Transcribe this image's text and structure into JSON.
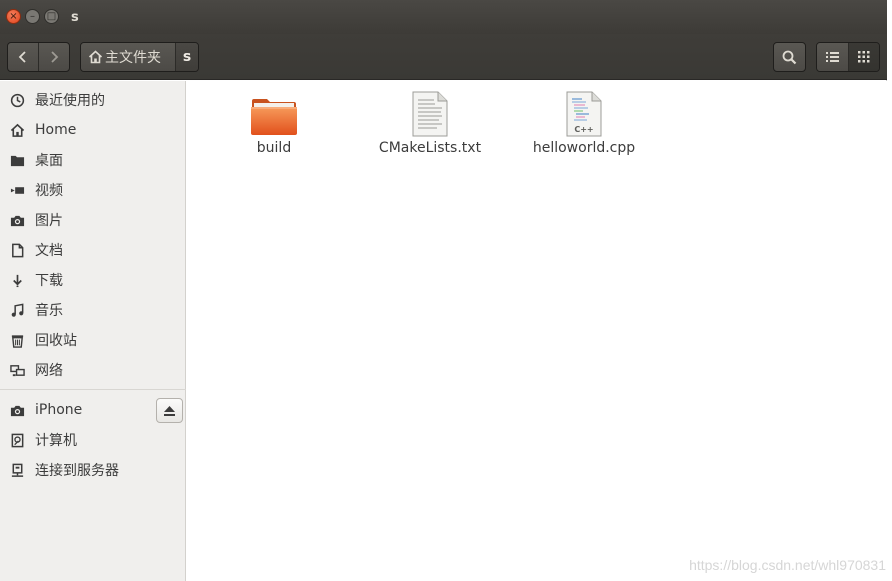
{
  "window": {
    "title": "s",
    "close_glyph": "×",
    "min_glyph": "–",
    "max_glyph": "□"
  },
  "toolbar": {
    "back_icon": "chevron-left-icon",
    "forward_icon": "chevron-right-icon",
    "path": [
      {
        "label": "主文件夹",
        "icon": "home-icon"
      },
      {
        "label": "s"
      }
    ],
    "search_icon": "search-icon",
    "list_view_icon": "list-view-icon",
    "grid_view_icon": "grid-view-icon"
  },
  "sidebar": {
    "places": [
      {
        "label": "最近使用的",
        "icon": "clock-icon"
      },
      {
        "label": "Home",
        "icon": "home-icon"
      },
      {
        "label": "桌面",
        "icon": "folder-icon"
      },
      {
        "label": "视频",
        "icon": "video-icon"
      },
      {
        "label": "图片",
        "icon": "camera-icon"
      },
      {
        "label": "文档",
        "icon": "document-icon"
      },
      {
        "label": "下载",
        "icon": "download-icon"
      },
      {
        "label": "音乐",
        "icon": "music-icon"
      },
      {
        "label": "回收站",
        "icon": "trash-icon"
      },
      {
        "label": "网络",
        "icon": "network-icon"
      }
    ],
    "devices": [
      {
        "label": "iPhone",
        "icon": "camera-icon"
      },
      {
        "label": "计算机",
        "icon": "computer-icon"
      },
      {
        "label": "连接到服务器",
        "icon": "server-icon"
      }
    ]
  },
  "files": [
    {
      "name": "build",
      "type": "folder"
    },
    {
      "name": "CMakeLists.txt",
      "type": "text"
    },
    {
      "name": "helloworld.cpp",
      "type": "cpp"
    }
  ],
  "watermark": "https://blog.csdn.net/whl970831"
}
